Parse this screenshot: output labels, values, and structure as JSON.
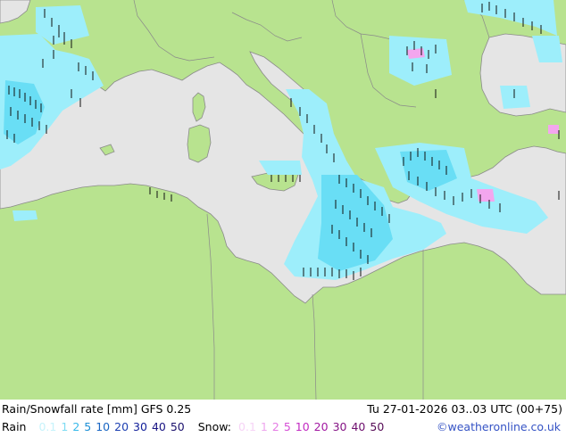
{
  "header": {
    "title": "Rain/Snowfall rate [mm]",
    "model": "GFS 0.25",
    "run": "Tu 27-01-2026 03..03 UTC (00+75)"
  },
  "legend": {
    "rain_label": "Rain",
    "rain_values": [
      {
        "text": "0.1",
        "color": "#c6f3fb"
      },
      {
        "text": "1",
        "color": "#7fdcf3"
      },
      {
        "text": "2",
        "color": "#37b9ea"
      },
      {
        "text": "5",
        "color": "#1e90d6"
      },
      {
        "text": "10",
        "color": "#1a66c3"
      },
      {
        "text": "20",
        "color": "#1c3fb1"
      },
      {
        "text": "30",
        "color": "#12209a"
      },
      {
        "text": "40",
        "color": "#1a1584"
      },
      {
        "text": "50",
        "color": "#190f6b"
      }
    ],
    "snow_label": "Snow:",
    "snow_values": [
      {
        "text": "0.1",
        "color": "#f6d3f6"
      },
      {
        "text": "1",
        "color": "#eea7ee"
      },
      {
        "text": "2",
        "color": "#e57ce5"
      },
      {
        "text": "5",
        "color": "#d64fd6"
      },
      {
        "text": "10",
        "color": "#c22ac2"
      },
      {
        "text": "20",
        "color": "#a219a2"
      },
      {
        "text": "30",
        "color": "#841384"
      },
      {
        "text": "40",
        "color": "#6e0f6e"
      },
      {
        "text": "50",
        "color": "#560b56"
      }
    ]
  },
  "copyright": "©weatheronline.co.uk",
  "colors": {
    "land": "#b8e38f",
    "sea": "#e5e5e5",
    "border": "#8a8a8a",
    "rain_light": "#9deefb",
    "rain_mid": "#69def5",
    "snow": "#f3a6ee"
  }
}
